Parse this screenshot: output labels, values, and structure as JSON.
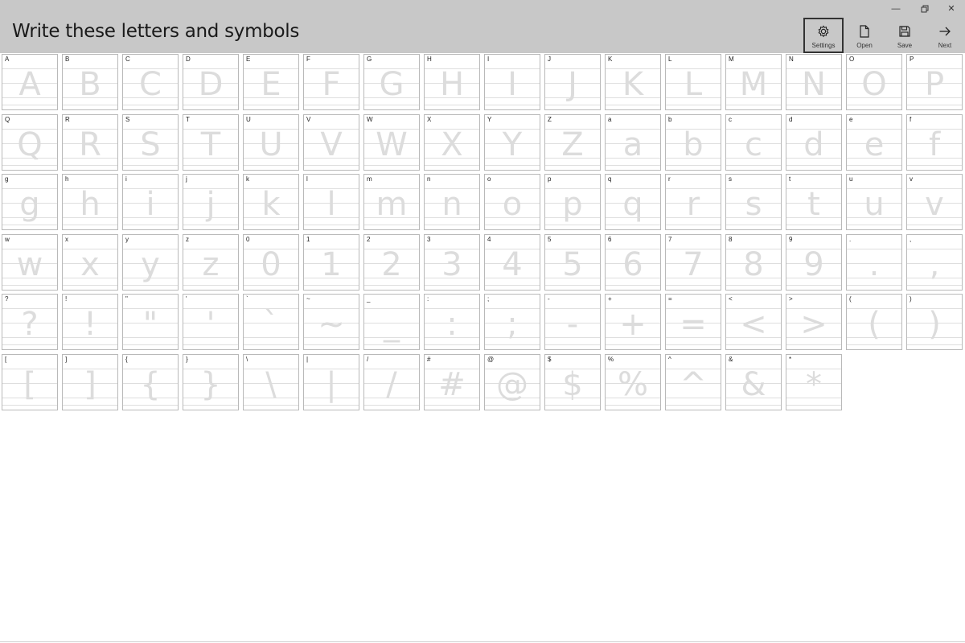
{
  "window": {
    "title": "Write these letters and symbols",
    "minimize_glyph": "—",
    "close_glyph": "✕"
  },
  "toolbar": {
    "settings_label": "Settings",
    "open_label": "Open",
    "save_label": "Save",
    "next_label": "Next"
  },
  "glyphs": [
    "A",
    "B",
    "C",
    "D",
    "E",
    "F",
    "G",
    "H",
    "I",
    "J",
    "K",
    "L",
    "M",
    "N",
    "O",
    "P",
    "Q",
    "R",
    "S",
    "T",
    "U",
    "V",
    "W",
    "X",
    "Y",
    "Z",
    "a",
    "b",
    "c",
    "d",
    "e",
    "f",
    "g",
    "h",
    "i",
    "j",
    "k",
    "l",
    "m",
    "n",
    "o",
    "p",
    "q",
    "r",
    "s",
    "t",
    "u",
    "v",
    "w",
    "x",
    "y",
    "z",
    "0",
    "1",
    "2",
    "3",
    "4",
    "5",
    "6",
    "7",
    "8",
    "9",
    ".",
    ",",
    "?",
    "!",
    "\"",
    "'",
    "`",
    "~",
    "_",
    ":",
    ";",
    "-",
    "+",
    "=",
    "<",
    ">",
    "(",
    ")",
    "[",
    "]",
    "{",
    "}",
    "\\",
    "|",
    "/",
    "#",
    "@",
    "$",
    "%",
    "^",
    "&",
    "*"
  ]
}
